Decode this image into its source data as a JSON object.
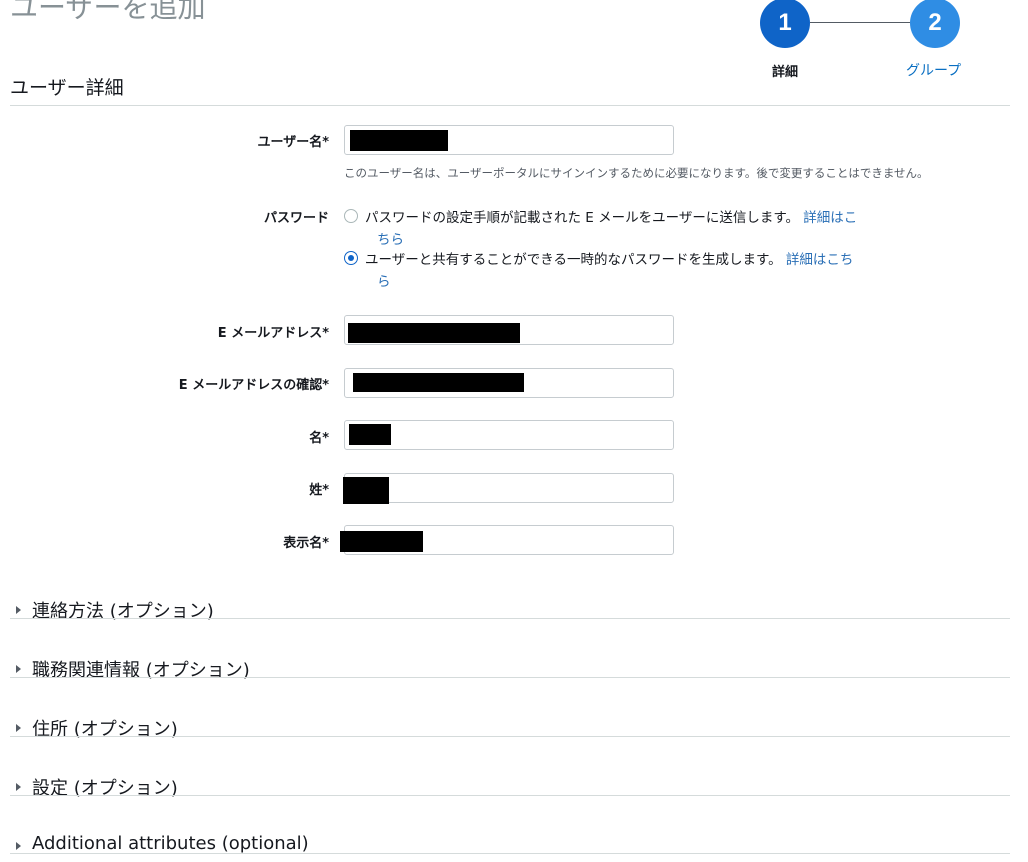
{
  "page": {
    "title": "ユーザーを追加"
  },
  "stepper": {
    "steps": [
      {
        "number": "1",
        "label": "詳細",
        "state": "current"
      },
      {
        "number": "2",
        "label": "グループ",
        "state": "next"
      }
    ]
  },
  "section": {
    "heading": "ユーザー詳細"
  },
  "form": {
    "username": {
      "label": "ユーザー名*",
      "hint": "このユーザー名は、ユーザーポータルにサインインするために必要になります。後で変更することはできません。"
    },
    "password": {
      "label": "パスワード",
      "options": [
        {
          "text": "パスワードの設定手順が記載された E メールをユーザーに送信します。",
          "link_first": "詳細はこ",
          "link_second": "ちら",
          "checked": false
        },
        {
          "text": "ユーザーと共有することができる一時的なパスワードを生成します。",
          "link_first": "詳細はこち",
          "link_second": "ら",
          "checked": true
        }
      ]
    },
    "email": {
      "label": "E メールアドレス*"
    },
    "email_confirm": {
      "label": "E メールアドレスの確認*"
    },
    "first_name": {
      "label": "名*"
    },
    "last_name": {
      "label": "姓*"
    },
    "display_name": {
      "label": "表示名*"
    }
  },
  "expanders": [
    {
      "label": "連絡方法 (オプション)"
    },
    {
      "label": "職務関連情報 (オプション)"
    },
    {
      "label": "住所 (オプション)"
    },
    {
      "label": "設定 (オプション)"
    },
    {
      "label": "Additional attributes (optional)"
    }
  ],
  "colors": {
    "step_current": "#0f64c8",
    "step_next": "#2f8de4",
    "link": "#2a6fb6",
    "radio_checked": "#0f64c8"
  }
}
